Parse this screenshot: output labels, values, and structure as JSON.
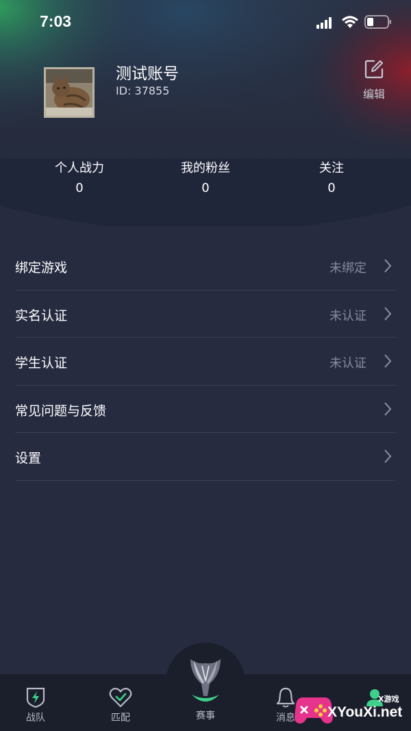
{
  "status_bar": {
    "time": "7:03"
  },
  "profile": {
    "name": "测试账号",
    "id_text": "ID: 37855",
    "edit_label": "编辑"
  },
  "stats": [
    {
      "label": "个人战力",
      "value": "0"
    },
    {
      "label": "我的粉丝",
      "value": "0"
    },
    {
      "label": "关注",
      "value": "0"
    }
  ],
  "menu": [
    {
      "label": "绑定游戏",
      "status": "未绑定"
    },
    {
      "label": "实名认证",
      "status": "未认证"
    },
    {
      "label": "学生认证",
      "status": "未认证"
    },
    {
      "label": "常见问题与反馈",
      "status": ""
    },
    {
      "label": "设置",
      "status": ""
    }
  ],
  "tab_bar": {
    "tabs": [
      {
        "label": "战队",
        "icon": "shield-bolt-icon"
      },
      {
        "label": "匹配",
        "icon": "heart-check-icon"
      },
      {
        "label": "赛事",
        "icon": "trophy-icon"
      },
      {
        "label": "消息",
        "icon": "bell-icon"
      },
      {
        "label": "",
        "icon": "profile-icon"
      }
    ]
  },
  "watermark": {
    "site": "XYouXi.net",
    "tag": "X游戏"
  },
  "colors": {
    "background": "#262b40",
    "tab_bar": "#1b1f2c",
    "accent_green": "#3ed08a",
    "muted_text": "#878b9c"
  }
}
